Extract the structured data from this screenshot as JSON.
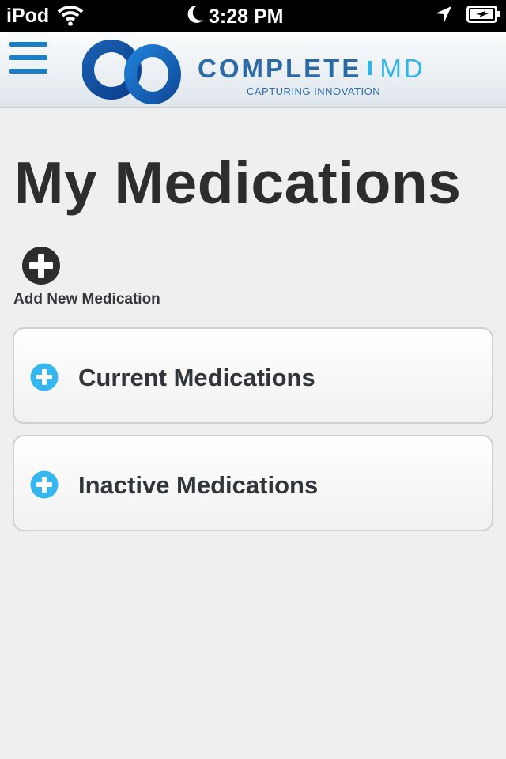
{
  "status_bar": {
    "carrier": "iPod",
    "time": "3:28 PM"
  },
  "header": {
    "logo_primary": "COMPLETE",
    "logo_secondary": "MD",
    "logo_tagline": "CAPTURING INNOVATION",
    "menu_icon": "hamburger-menu-icon",
    "accent_color": "#1a7fc6",
    "secondary_color": "#2fb5ea"
  },
  "page": {
    "title": "My Medications",
    "add_new_label": "Add New Medication"
  },
  "sections": [
    {
      "label": "Current Medications",
      "icon": "plus-circle-icon",
      "expanded": false
    },
    {
      "label": "Inactive Medications",
      "icon": "plus-circle-icon",
      "expanded": false
    }
  ]
}
